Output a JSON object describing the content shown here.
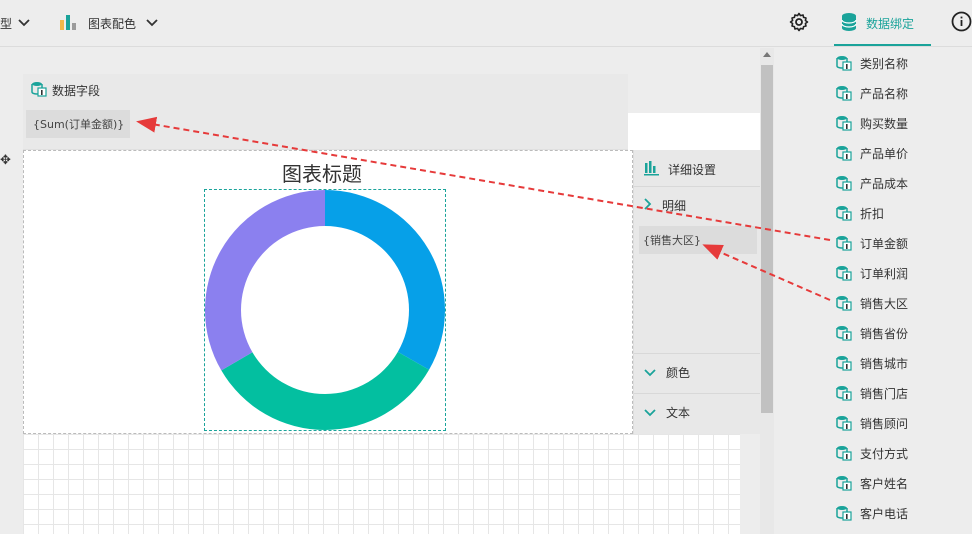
{
  "toolbar": {
    "chart_type_label": "型",
    "chart_color_label": "图表配色",
    "data_binding_label": "数据绑定"
  },
  "data_field_panel": {
    "title": "数据字段",
    "value": "{Sum(订单金额)}"
  },
  "chart": {
    "title": "图表标题",
    "chart_data": {
      "type": "pie",
      "categories": [
        "",
        "",
        ""
      ],
      "values": [
        33.3,
        33.3,
        33.4
      ],
      "colors": [
        "#06a0e8",
        "#03bfa0",
        "#8b80ef"
      ]
    }
  },
  "detail_panel": {
    "settings_label": "详细设置",
    "detail_label": "明细",
    "detail_value": "{销售大区}",
    "color_label": "颜色",
    "text_label": "文本"
  },
  "fields": [
    "类别名称",
    "产品名称",
    "购买数量",
    "产品单价",
    "产品成本",
    "折扣",
    "订单金额",
    "订单利润",
    "销售大区",
    "销售省份",
    "销售城市",
    "销售门店",
    "销售顾问",
    "支付方式",
    "客户姓名",
    "客户电话"
  ],
  "colors": {
    "accent": "#1aa39a",
    "arrow": "#e63a3a"
  }
}
